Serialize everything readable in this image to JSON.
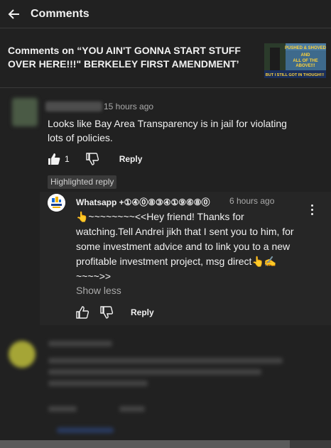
{
  "header": {
    "title": "Comments",
    "back_icon": "arrow-left-icon"
  },
  "context": {
    "text": "Comments on “YOU AIN'T GONNA START STUFF OVER HERE!!!\" BERKELEY FIRST AMENDMENT’",
    "thumbnail": {
      "top_caption": "PUSHED & SHOVED AND ... ALL OF THE ABOVE!!!",
      "bottom_caption": "BUT I STILL GOT IN THOUGH!!!"
    }
  },
  "comment": {
    "time": "15 hours ago",
    "text": "Looks like Bay Area Transparency is in jail for violating lots of policies.",
    "like_count": "1",
    "reply_label": "Reply"
  },
  "highlight": {
    "label": "Highlighted reply"
  },
  "reply": {
    "author": "Whatsapp +①④⓪⑧③④①⑨⑥⑧⓪",
    "time": "6 hours ago",
    "text": "👆~~~~~~~~<<Hey friend! Thanks for watching.Tell Andrei jikh that I sent you to him, for some investment advice and to link you to a new profitable investment project, msg direct👆✍️ ~~~~>>",
    "show_less": "Show less",
    "reply_label": "Reply"
  }
}
